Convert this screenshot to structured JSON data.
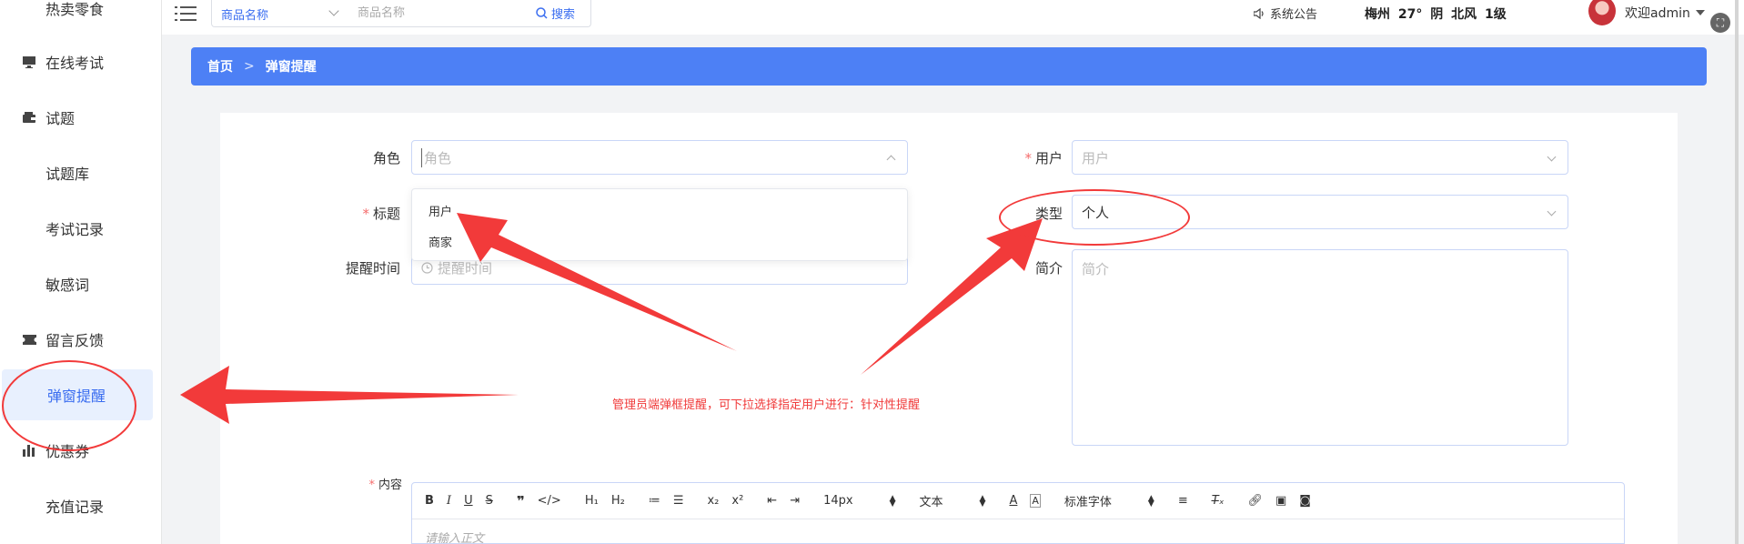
{
  "sidebar": {
    "items": [
      {
        "label": "热卖零食",
        "icon": "grid-icon"
      },
      {
        "label": "在线考试",
        "icon": "monitor-icon"
      },
      {
        "label": "试题",
        "icon": "wallet-icon"
      },
      {
        "label": "试题库",
        "icon": "grid9-icon"
      },
      {
        "label": "考试记录",
        "icon": "grid-icon"
      },
      {
        "label": "敏感词",
        "icon": "grid-icon"
      },
      {
        "label": "留言反馈",
        "icon": "ticket-icon"
      },
      {
        "label": "弹窗提醒",
        "icon": "grid-icon",
        "active": true
      },
      {
        "label": "优惠券",
        "icon": "bar-chart-icon"
      },
      {
        "label": "充值记录",
        "icon": "grid-icon"
      }
    ]
  },
  "topbar": {
    "search_select": "商品名称",
    "search_placeholder": "商品名称",
    "search_button": "搜索",
    "notice": "系统公告",
    "weather": "梅州 27° 阴 北风 1级",
    "welcome": "欢迎admin"
  },
  "breadcrumb": {
    "home": "首页",
    "separator": ">",
    "current": "弹窗提醒"
  },
  "form": {
    "role_label": "角色",
    "role_placeholder": "角色",
    "user_label": "用户",
    "user_placeholder": "用户",
    "title_label": "标题",
    "type_label": "类型",
    "type_value": "个人",
    "remind_time_label": "提醒时间",
    "remind_time_placeholder": "提醒时间",
    "intro_label": "简介",
    "intro_placeholder": "简介",
    "content_label": "内容",
    "role_options": [
      "用户",
      "商家"
    ]
  },
  "annotation": {
    "text": "管理员端弹框提醒，可下拉选择指定用户进行：针对性提醒",
    "color": "#f23a3a"
  },
  "editor": {
    "font_size": "14px",
    "block_type": "文本",
    "font_family": "标准字体",
    "placeholder": "请输入正文"
  },
  "colors": {
    "accent": "#4d80f5",
    "required": "#f56c6c"
  }
}
